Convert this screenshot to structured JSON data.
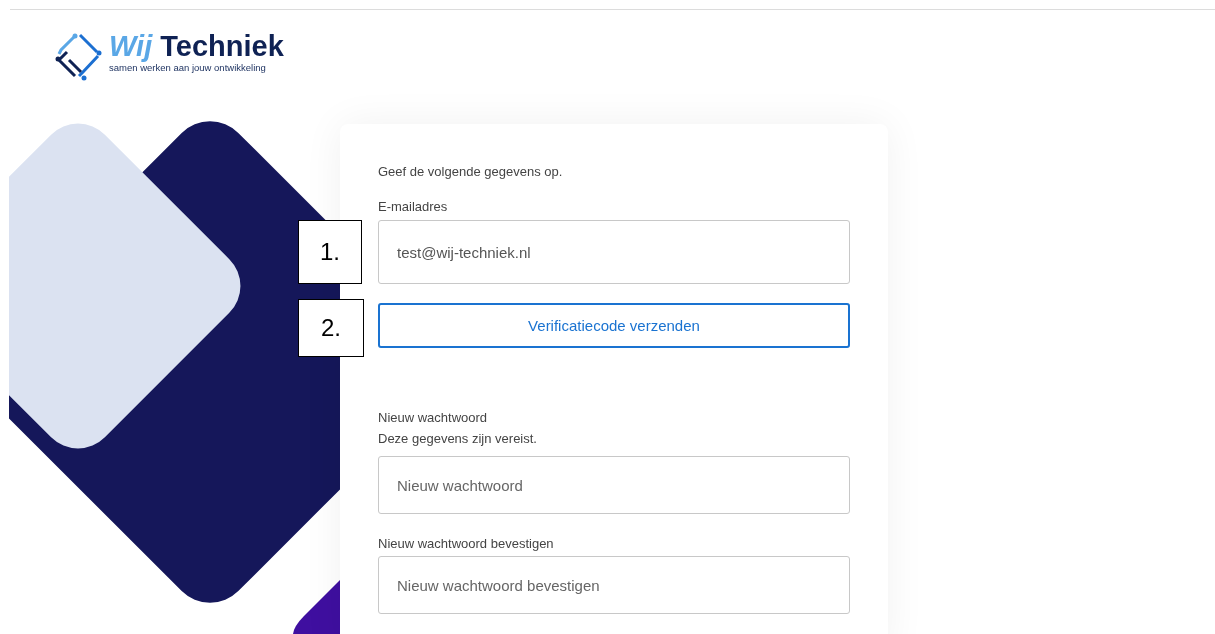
{
  "logo": {
    "brand_first": "Wij",
    "brand_second": "Techniek",
    "tagline": "samen werken aan jouw ontwikkeling"
  },
  "form": {
    "intro": "Geef de volgende gegevens op.",
    "email": {
      "label": "E-mailadres",
      "value": "test@wij-techniek.nl",
      "callout": "1."
    },
    "send_button": {
      "label": "Verificatiecode verzenden",
      "callout": "2."
    },
    "new_password": {
      "label": "Nieuw wachtwoord",
      "hint": "Deze gegevens zijn vereist.",
      "placeholder": "Nieuw wachtwoord"
    },
    "confirm_password": {
      "label": "Nieuw wachtwoord bevestigen",
      "placeholder": "Nieuw wachtwoord bevestigen"
    }
  }
}
